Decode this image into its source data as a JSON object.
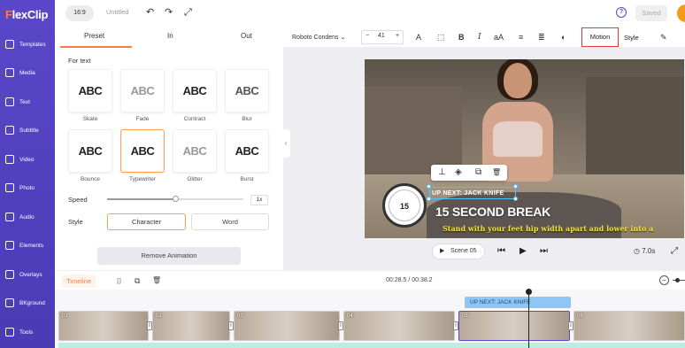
{
  "app": {
    "logo_prefix": "F",
    "logo_suffix": "lexClip"
  },
  "topbar": {
    "ratio": "16:9",
    "title_placeholder": "Untitled",
    "undo_icon": "↶",
    "redo_icon": "↷",
    "fullscreen_icon": "⤢",
    "help_icon": "?",
    "saved_label": "Saved"
  },
  "sidebar": {
    "items": [
      {
        "label": "Templates",
        "icon": "templates-icon"
      },
      {
        "label": "Media",
        "icon": "media-icon"
      },
      {
        "label": "Text",
        "icon": "text-icon"
      },
      {
        "label": "Subtitle",
        "icon": "subtitle-icon"
      },
      {
        "label": "Video",
        "icon": "video-icon"
      },
      {
        "label": "Photo",
        "icon": "photo-icon"
      },
      {
        "label": "Audio",
        "icon": "audio-icon"
      },
      {
        "label": "Elements",
        "icon": "elements-icon"
      },
      {
        "label": "Overlays",
        "icon": "overlays-icon"
      },
      {
        "label": "BKground",
        "icon": "background-icon"
      },
      {
        "label": "Tools",
        "icon": "tools-icon"
      }
    ]
  },
  "panel": {
    "tabs": [
      "Preset",
      "In",
      "Out"
    ],
    "active_tab": "Preset",
    "section_title": "For text",
    "sample_text": "ABC",
    "animations": [
      {
        "label": "Skate"
      },
      {
        "label": "Fade"
      },
      {
        "label": "Contract"
      },
      {
        "label": "Blur"
      },
      {
        "label": "Bounce"
      },
      {
        "label": "Typewriter",
        "selected": true
      },
      {
        "label": "Glitter"
      },
      {
        "label": "Burst"
      }
    ],
    "speed_label": "Speed",
    "speed_value": "1x",
    "speed_fraction": 0.5,
    "style_label": "Style",
    "style_options": [
      "Character",
      "Word"
    ],
    "style_active": "Character",
    "remove_label": "Remove Animation",
    "collapse_icon": "‹"
  },
  "text_toolbar": {
    "font": "Roboto Condens",
    "font_dropdown_icon": "⌄",
    "minus": "−",
    "size": "41",
    "plus": "+",
    "color_icon": "A",
    "fill_icon": "⬚",
    "bold": "B",
    "italic": "I",
    "case": "aA",
    "align_icon": "≡",
    "spacing_icon": "≣",
    "effect_icon": "◐",
    "motion_label": "Motion",
    "style_label": "Style",
    "edit_icon": "✎"
  },
  "preview": {
    "up_next": "UP NEXT: JACK KNIFE",
    "title": "15 SECOND BREAK",
    "caption": "Stand with your feet hip width apart and lower into a",
    "clock_value": "15",
    "float_toolbar_icons": [
      "⊥",
      "◈",
      "⧉",
      "🗑"
    ]
  },
  "playback": {
    "scene_label": "Scene 05",
    "play_icon": "▶",
    "prev_icon": "⏮",
    "next_icon": "⏭",
    "duration": "7.0s",
    "clock_icon": "◷",
    "fullscreen_icon": "⤢"
  },
  "timeline": {
    "label": "Timeline",
    "current_time": "00:28.5",
    "total_time": "00:38.2",
    "separator": "/",
    "split_icon": "⌷",
    "duplicate_icon": "⧉",
    "delete_icon": "🗑",
    "zoom_out_icon": "−",
    "text_clip_label": "UP NEXT: JACK KNIFE",
    "clips": [
      "01",
      "02",
      "03",
      "04",
      "05",
      "06"
    ],
    "active_clip": "05",
    "divider_icon": "I"
  }
}
